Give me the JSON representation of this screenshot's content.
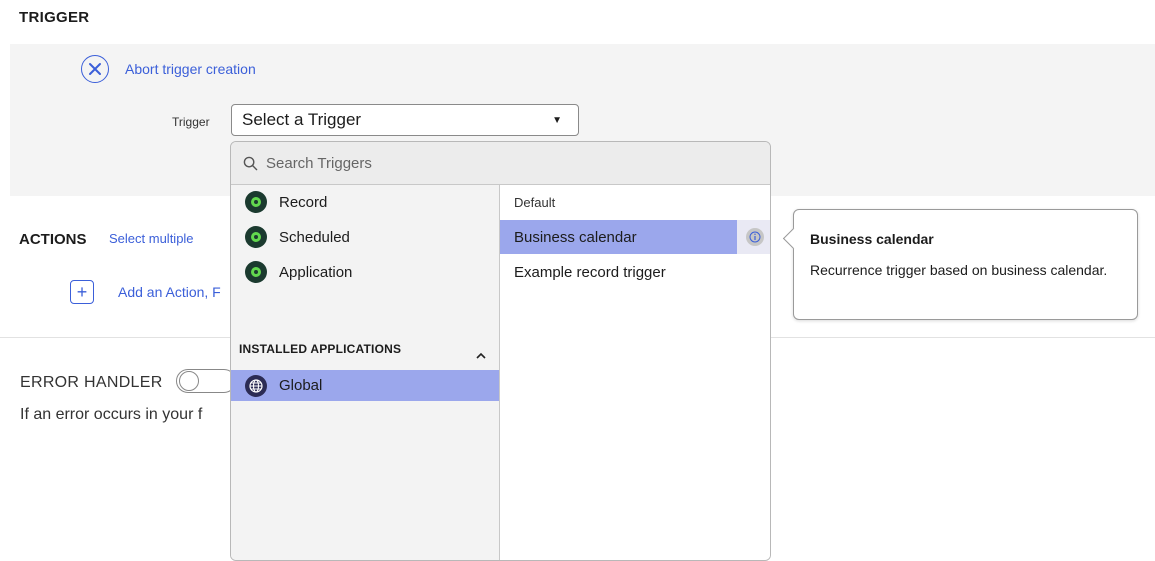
{
  "trigger_section": {
    "heading": "TRIGGER",
    "abort_label": "Abort trigger creation",
    "trigger_field_label": "Trigger",
    "trigger_select_value": "Select a Trigger"
  },
  "actions_section": {
    "heading": "ACTIONS",
    "select_multiple_label": "Select multiple",
    "add_action_label": "Add an Action, F"
  },
  "error_section": {
    "heading": "ERROR HANDLER",
    "toggle_state": "off",
    "description": "If an error occurs in your f"
  },
  "dropdown": {
    "search_placeholder": "Search Triggers",
    "categories": [
      {
        "label": "Record",
        "icon": "record-icon"
      },
      {
        "label": "Scheduled",
        "icon": "scheduled-icon"
      },
      {
        "label": "Application",
        "icon": "application-icon"
      }
    ],
    "installed_heading": "INSTALLED APPLICATIONS",
    "installed_items": [
      {
        "label": "Global",
        "icon": "globe-icon",
        "selected": true
      }
    ],
    "group_heading": "Default",
    "triggers": [
      {
        "label": "Business calendar",
        "selected": true
      },
      {
        "label": "Example record trigger",
        "selected": false
      }
    ]
  },
  "tooltip": {
    "title": "Business calendar",
    "body": "Recurrence trigger based on business calendar."
  },
  "colors": {
    "accent": "#3b5fd9",
    "selection": "#9ba7ec",
    "panel": "#f4f4f4",
    "icon_green": "#62d84e"
  }
}
